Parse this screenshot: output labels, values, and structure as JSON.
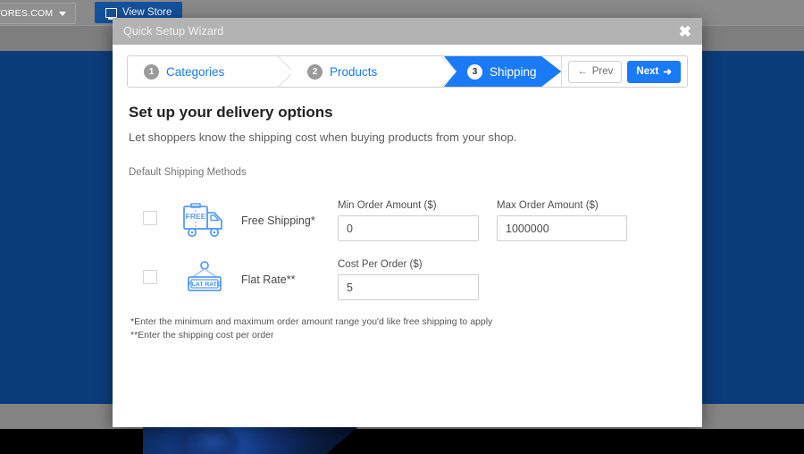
{
  "background": {
    "account_menu_label": "…CARTSTORES.COM",
    "view_store_label": "View Store",
    "caret_icon": "chevron-down-icon",
    "monitor_icon": "monitor-icon",
    "blue_band_color": "#0a3c78",
    "overlay_color": "#8a8a8a"
  },
  "modal": {
    "title": "Quick Setup Wizard",
    "close_label": "✖",
    "header_bg": "#b3b3b3"
  },
  "wizard": {
    "accent_color": "#1a7af8",
    "steps": [
      {
        "number": "1",
        "label": "Categories",
        "active": false
      },
      {
        "number": "2",
        "label": "Products",
        "active": false
      },
      {
        "number": "3",
        "label": "Shipping",
        "active": true
      }
    ],
    "prev_label": "Prev",
    "next_label": "Next",
    "prev_icon": "arrow-left-icon",
    "next_icon": "arrow-right-icon"
  },
  "content": {
    "heading": "Set up your delivery options",
    "subheading": "Let shoppers know the shipping cost when buying products from your shop.",
    "section_label": "Default Shipping Methods",
    "methods": [
      {
        "name": "Free Shipping*",
        "icon": "free-shipping-truck-icon",
        "icon_text": "FREE",
        "checked": false,
        "fields": [
          {
            "label": "Min Order Amount ($)",
            "value": "0",
            "placeholder": "0"
          },
          {
            "label": "Max Order Amount ($)",
            "value": "1000000",
            "placeholder": "0"
          }
        ]
      },
      {
        "name": "Flat Rate**",
        "icon": "flat-rate-sign-icon",
        "icon_text": "FLAT RATE",
        "checked": false,
        "fields": [
          {
            "label": "Cost Per Order ($)",
            "value": "5",
            "placeholder": "0"
          }
        ]
      }
    ],
    "footnotes": [
      "*Enter the minimum and maximum order amount range you'd like free shipping to apply",
      "**Enter the shipping cost per order"
    ]
  }
}
